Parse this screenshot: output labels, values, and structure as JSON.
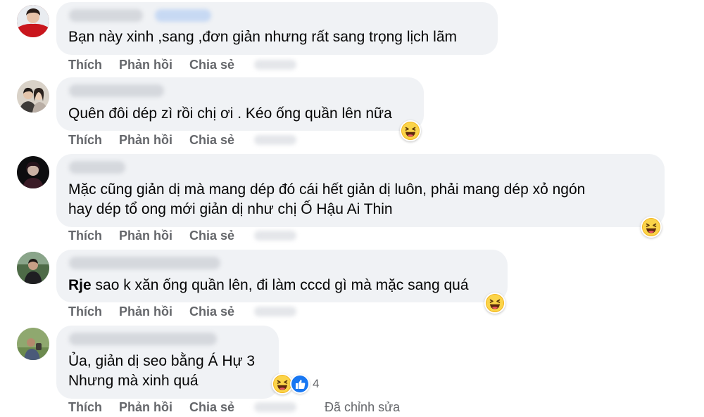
{
  "actions": {
    "like": "Thích",
    "reply": "Phản hồi",
    "share": "Chia sẻ",
    "edited": "Đã chỉnh sửa"
  },
  "comments": [
    {
      "lines": [
        "Bạn này xinh ,sang ,đơn giản nhưng rất sang trọng lịch lãm"
      ]
    },
    {
      "lines": [
        "Quên đôi dép zì rồi chị ơi . Kéo ống quần lên nữa"
      ]
    },
    {
      "lines": [
        "Mặc cũng giản dị mà mang dép đó cái hết giản dị luôn, phải mang dép xỏ ngón",
        "hay dép tổ ong mới giản dị như chị Ố Hậu Ai Thin"
      ]
    },
    {
      "mention": "Rje",
      "lines": [
        "sao k xăn ống quần lên, đi làm cccd gì mà mặc sang quá"
      ]
    },
    {
      "lines": [
        "Ủa, giản dị seo bằng Á Hự 3",
        "Nhưng mà xinh quá"
      ],
      "reaction_count": "4"
    }
  ],
  "icons": {
    "haha": "haha-reaction-icon",
    "like": "like-reaction-icon"
  },
  "colors": {
    "bubble": "#f0f2f5",
    "action": "#65676b",
    "like_blue": "#1877f2",
    "haha_yellow": "#f7b125"
  }
}
